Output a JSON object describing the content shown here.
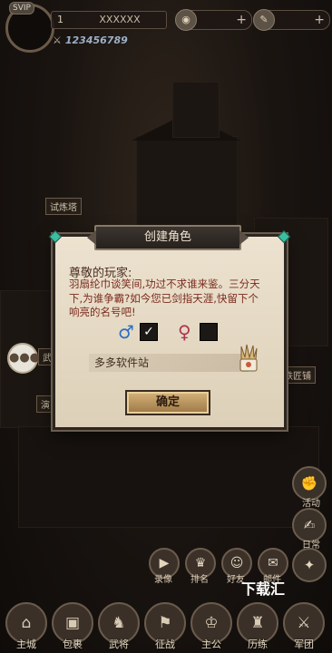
{
  "top_bar": {
    "vip": "SVIP",
    "level": "1",
    "player_name": "XXXXXX",
    "power": "123456789",
    "resource1_icon": "coin-icon",
    "resource2_icon": "food-icon"
  },
  "map_labels": {
    "tower": "试炼塔",
    "smithy": "铁匠铺",
    "arena_left": "演",
    "wu": "武"
  },
  "dialog": {
    "title": "创建角色",
    "greeting": "尊敬的玩家:",
    "description": "羽扇纶巾谈笑间,功过不求谁来鉴。三分天下,为谁争霸?如今您已剑指天涯,快留下个响亮的名号吧!",
    "male_symbol": "♂",
    "female_symbol": "♀",
    "male_checked": true,
    "female_checked": false,
    "name_value": "多多软件站",
    "confirm_label": "确定"
  },
  "side_buttons": {
    "activity": "活动",
    "daily": "日常"
  },
  "mid_row": [
    {
      "label": "录像",
      "icon": "video-icon"
    },
    {
      "label": "排名",
      "icon": "trophy-icon"
    },
    {
      "label": "好友",
      "icon": "friends-icon"
    },
    {
      "label": "邮件",
      "icon": "mail-icon"
    }
  ],
  "bottom_nav": [
    {
      "label": "主城",
      "icon": "castle-icon"
    },
    {
      "label": "包裹",
      "icon": "bag-icon"
    },
    {
      "label": "武将",
      "icon": "general-icon"
    },
    {
      "label": "征战",
      "icon": "battle-icon"
    },
    {
      "label": "主公",
      "icon": "lord-icon"
    },
    {
      "label": "历练",
      "icon": "training-icon"
    },
    {
      "label": "军团",
      "icon": "legion-icon"
    }
  ],
  "watermark": "下载汇"
}
